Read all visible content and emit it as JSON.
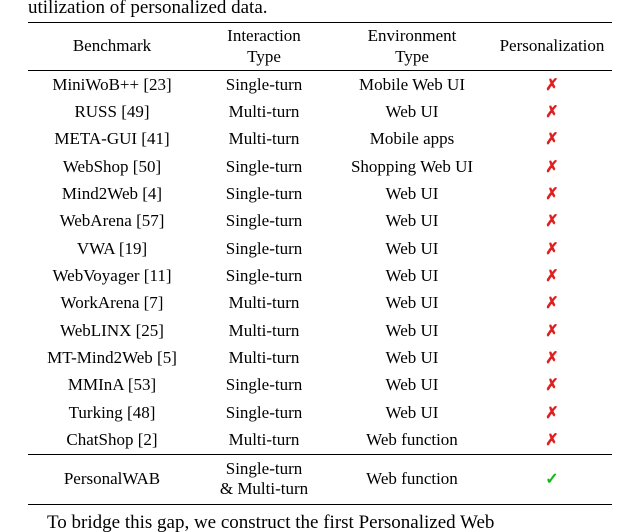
{
  "fragments": {
    "top": "utilization of personalized data.",
    "bottom": " To bridge this gap, we construct the first Personalized Web"
  },
  "symbols": {
    "cross": "✗",
    "check": "✓"
  },
  "chart_data": {
    "type": "table",
    "title": "",
    "columns": [
      "Benchmark",
      "Interaction Type",
      "Environment Type",
      "Personalization"
    ],
    "columns_split": {
      "1a": "Interaction",
      "1b": "Type",
      "2a": "Environment",
      "2b": "Type"
    },
    "rows": [
      {
        "benchmark": "MiniWoB++ [23]",
        "interaction": "Single-turn",
        "environment": "Mobile Web UI",
        "personalization": false
      },
      {
        "benchmark": "RUSS [49]",
        "interaction": "Multi-turn",
        "environment": "Web UI",
        "personalization": false
      },
      {
        "benchmark": "META-GUI [41]",
        "interaction": "Multi-turn",
        "environment": "Mobile apps",
        "personalization": false
      },
      {
        "benchmark": "WebShop [50]",
        "interaction": "Single-turn",
        "environment": "Shopping Web UI",
        "personalization": false
      },
      {
        "benchmark": "Mind2Web [4]",
        "interaction": "Single-turn",
        "environment": "Web UI",
        "personalization": false
      },
      {
        "benchmark": "WebArena [57]",
        "interaction": "Single-turn",
        "environment": "Web UI",
        "personalization": false
      },
      {
        "benchmark": "VWA [19]",
        "interaction": "Single-turn",
        "environment": "Web UI",
        "personalization": false
      },
      {
        "benchmark": "WebVoyager [11]",
        "interaction": "Single-turn",
        "environment": "Web UI",
        "personalization": false
      },
      {
        "benchmark": "WorkArena [7]",
        "interaction": "Multi-turn",
        "environment": "Web UI",
        "personalization": false
      },
      {
        "benchmark": "WebLINX [25]",
        "interaction": "Multi-turn",
        "environment": "Web UI",
        "personalization": false
      },
      {
        "benchmark": "MT-Mind2Web [5]",
        "interaction": "Multi-turn",
        "environment": "Web UI",
        "personalization": false
      },
      {
        "benchmark": "MMInA [53]",
        "interaction": "Single-turn",
        "environment": "Web UI",
        "personalization": false
      },
      {
        "benchmark": "Turking [48]",
        "interaction": "Single-turn",
        "environment": "Web UI",
        "personalization": false
      },
      {
        "benchmark": "ChatShop [2]",
        "interaction": "Multi-turn",
        "environment": "Web function",
        "personalization": false
      }
    ],
    "footer": {
      "benchmark": "PersonalWAB",
      "interaction_lines": [
        "Single-turn",
        "& Multi-turn"
      ],
      "environment": "Web function",
      "personalization": true
    }
  }
}
